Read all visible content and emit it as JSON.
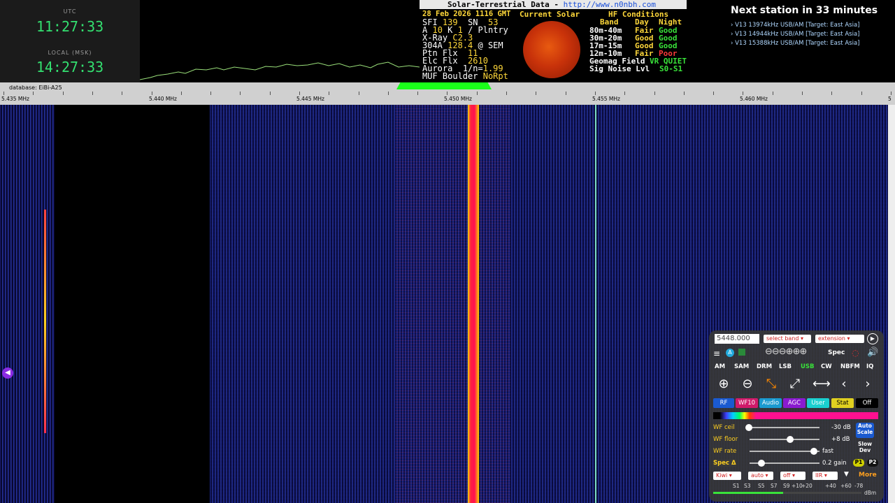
{
  "clock": {
    "utc_label": "UTC",
    "utc_time": "11:27:33",
    "local_label": "LOCAL (MSK)",
    "local_time": "14:27:33"
  },
  "solar": {
    "title": "Solar-Terrestrial Data - ",
    "url": "http://www.n0nbh.com",
    "date": "28 Feb 2026 1116 GMT",
    "sfi_label": "SFI",
    "sfi": "139",
    "sn_label": "SN",
    "sn": "53",
    "a_label": "A",
    "a": "10",
    "k_label": "K",
    "k": "1",
    "k_suffix": "/ Plntry",
    "xray_label": "X-Ray",
    "xray": "C2.3",
    "f304_label": "304A",
    "f304": "128.4",
    "f304_suffix": "@ SEM",
    "ptn_label": "Ptn Flx",
    "ptn": "11",
    "elc_label": "Elc Flx",
    "elc": "2610",
    "aurora_label": "Aurora",
    "aurora": "1/n=",
    "aurora_val": "1.99",
    "muf_label": "MUF Boulder",
    "muf": "NoRpt",
    "current_solar": "Current Solar",
    "hf_title": "HF Conditions",
    "hf_band_h": "Band",
    "hf_day_h": "Day",
    "hf_night_h": "Night",
    "hf_rows": [
      {
        "band": "80m-40m",
        "day": "Fair",
        "night": "Good"
      },
      {
        "band": "30m-20m",
        "day": "Good",
        "night": "Good"
      },
      {
        "band": "17m-15m",
        "day": "Good",
        "night": "Good"
      },
      {
        "band": "12m-10m",
        "day": "Fair",
        "night": "Poor"
      }
    ],
    "geomag_label": "Geomag Field",
    "geomag": "VR QUIET",
    "signoise_label": "Sig Noise Lvl",
    "signoise": "S0-S1"
  },
  "next_station": {
    "title": "Next station in 33 minutes",
    "items": [
      "› V13 13974kHz USB/AM [Target: East Asia]",
      "› V13 14944kHz USB/AM [Target: East Asia]",
      "› V13 15388kHz USB/AM [Target: East Asia]"
    ]
  },
  "scale": {
    "database": "database: EiBi-A25",
    "ticks": [
      "5.435 MHz",
      "5.440 MHz",
      "5.445 MHz",
      "5.450 MHz",
      "5.455 MHz",
      "5.460 MHz",
      "5"
    ]
  },
  "control": {
    "frequency": "5448.000",
    "select_band": "select band",
    "extension": "extension",
    "spec": "Spec",
    "modes": [
      "AM",
      "SAM",
      "DRM",
      "LSB",
      "USB",
      "CW",
      "NBFM",
      "IQ"
    ],
    "tabs": [
      "RF",
      "WF10",
      "Audio",
      "AGC",
      "User",
      "Stat",
      "Off"
    ],
    "wf_ceil_label": "WF ceil",
    "wf_ceil": "-30 dB",
    "wf_floor_label": "WF floor",
    "wf_floor": "+8 dB",
    "wf_rate_label": "WF rate",
    "wf_rate": "fast",
    "spec_label": "Spec Δ",
    "spec_val": "0.2 gain",
    "auto_scale": "Auto Scale",
    "slow_dev": "Slow Dev",
    "p1": "P1",
    "p2": "P2",
    "kiwi": "Kiwi",
    "auto": "auto",
    "off": "off",
    "iir": "IIR",
    "more": "More",
    "smeter": [
      "S1",
      "S3",
      "S5",
      "S7",
      "S9",
      "+10",
      "+20",
      "+40",
      "+60",
      "-78"
    ],
    "dbm": "dBm"
  },
  "colors": {
    "clock_green": "#33e070",
    "usb_active": "#39e23a"
  }
}
